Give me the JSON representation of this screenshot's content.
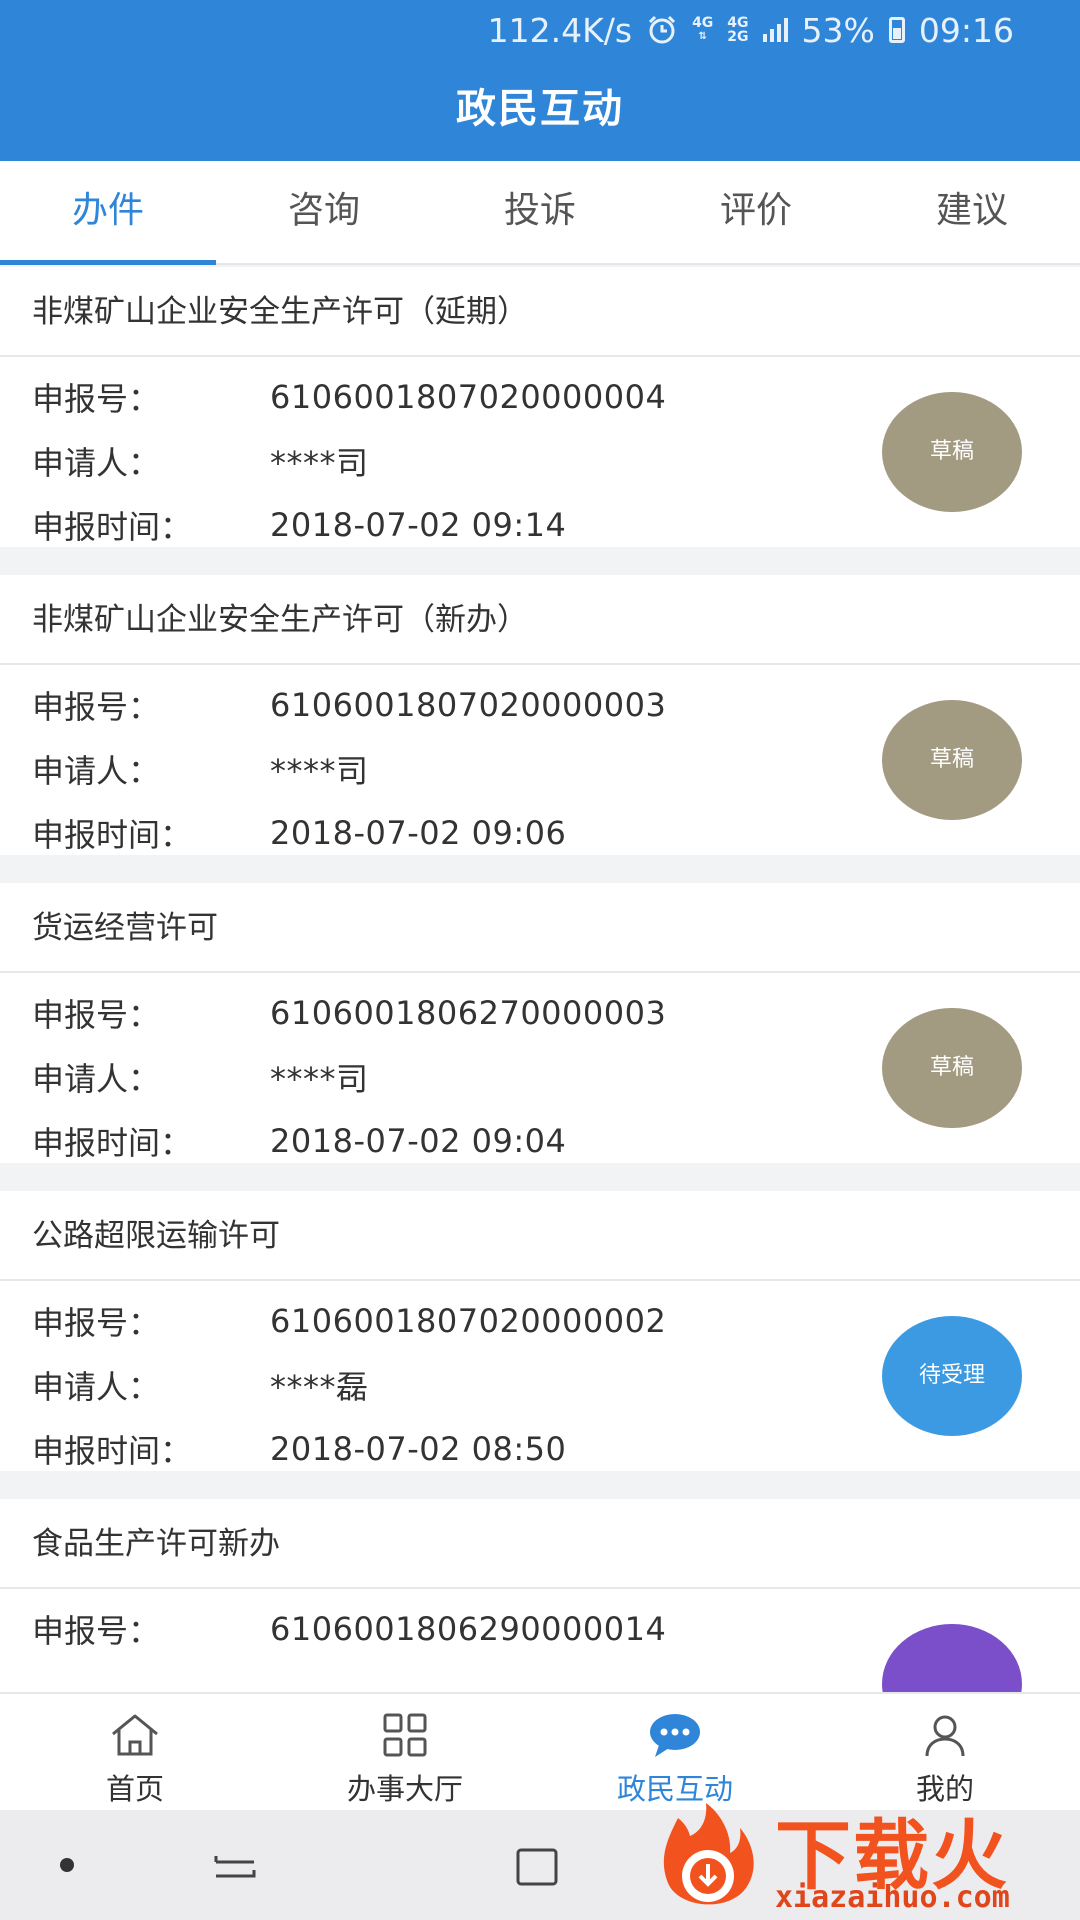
{
  "status_bar": {
    "speed": "112.4K/s",
    "net_top": "4G",
    "net_dual": [
      "4G",
      "2G"
    ],
    "battery": "53%",
    "time": "09:16",
    "icons": [
      "alarm-icon",
      "4g-icon",
      "signal-icon",
      "battery-icon"
    ]
  },
  "header": {
    "title": "政民互动"
  },
  "tabs": [
    {
      "label": "办件",
      "active": true
    },
    {
      "label": "咨询",
      "active": false
    },
    {
      "label": "投诉",
      "active": false
    },
    {
      "label": "评价",
      "active": false
    },
    {
      "label": "建议",
      "active": false
    }
  ],
  "labels": {
    "number": "申报号：",
    "applicant": "申请人：",
    "time": "申报时间："
  },
  "records": [
    {
      "title": "非煤矿山企业安全生产许可（延期）",
      "number": "6106001807020000004",
      "applicant": "****司",
      "time": "2018-07-02 09:14",
      "status": "草稿",
      "status_color": "#a39a82"
    },
    {
      "title": "非煤矿山企业安全生产许可（新办）",
      "number": "6106001807020000003",
      "applicant": "****司",
      "time": "2018-07-02 09:06",
      "status": "草稿",
      "status_color": "#a39a82"
    },
    {
      "title": "货运经营许可",
      "number": "6106001806270000003",
      "applicant": "****司",
      "time": "2018-07-02 09:04",
      "status": "草稿",
      "status_color": "#a39a82"
    },
    {
      "title": "公路超限运输许可",
      "number": "6106001807020000002",
      "applicant": "****磊",
      "time": "2018-07-02 08:50",
      "status": "待受理",
      "status_color": "#3b9ae1"
    },
    {
      "title": "食品生产许可新办",
      "number": "6106001806290000014",
      "applicant": "",
      "time": "",
      "status": "",
      "status_color": "#7b4fc9"
    }
  ],
  "bottom_nav": [
    {
      "label": "首页",
      "icon": "home-icon",
      "active": false
    },
    {
      "label": "办事大厅",
      "icon": "grid-icon",
      "active": false
    },
    {
      "label": "政民互动",
      "icon": "chat-icon",
      "active": true
    },
    {
      "label": "我的",
      "icon": "user-icon",
      "active": false
    }
  ],
  "watermark": {
    "text": "下载火",
    "url": "xiazaihuo.com"
  },
  "colors": {
    "primary": "#2f86d8",
    "draft": "#a39a82",
    "pending": "#3b9ae1"
  }
}
